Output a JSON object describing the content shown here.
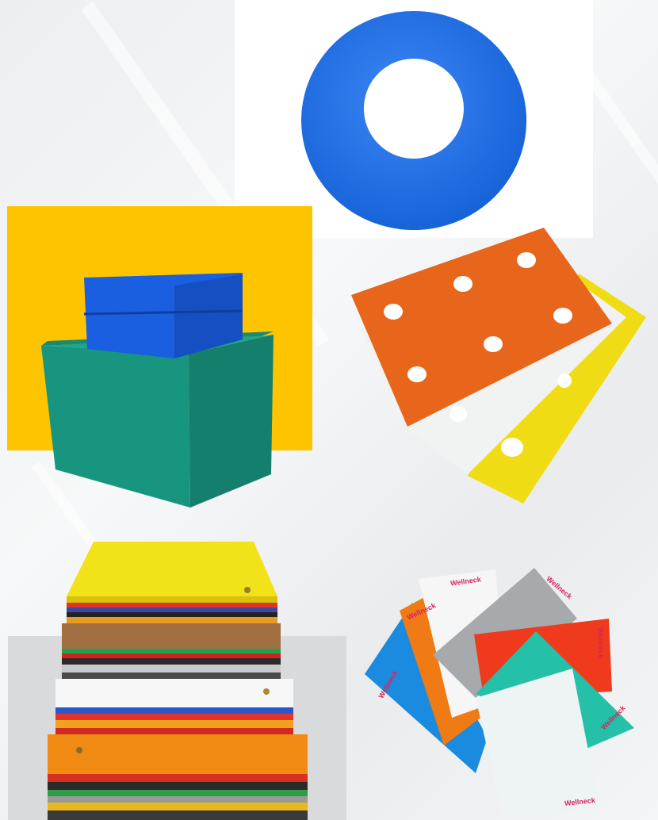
{
  "colors": {
    "background": "#eef0f2",
    "ring_blue": "#1f6fe8",
    "box_yellow_bg": "#ffc400",
    "box_blue": "#1a5fe0",
    "box_green": "#18957f",
    "sheet_orange": "#e8651c",
    "sheet_white": "#f1f2f2",
    "sheet_yellow": "#f0dc14",
    "stack_grey_bg": "#d8dadc",
    "sheet_red": "#ef3a1e",
    "sheet_teal": "#25c0a8",
    "sheet_grey": "#a7aaad",
    "label_pink": "#d8245c"
  },
  "images": {
    "ring": "blue-plastic-ring-washer",
    "boxes": "green-and-blue-corrugated-plastic-boxes",
    "perforated_sheets": "orange-white-yellow-perforated-sheets",
    "stack": "stack-of-colored-corrugated-sheets",
    "fan": "fanned-colored-corrugated-sheets-with-labels"
  },
  "labels": {
    "brand": "Wellneck"
  }
}
